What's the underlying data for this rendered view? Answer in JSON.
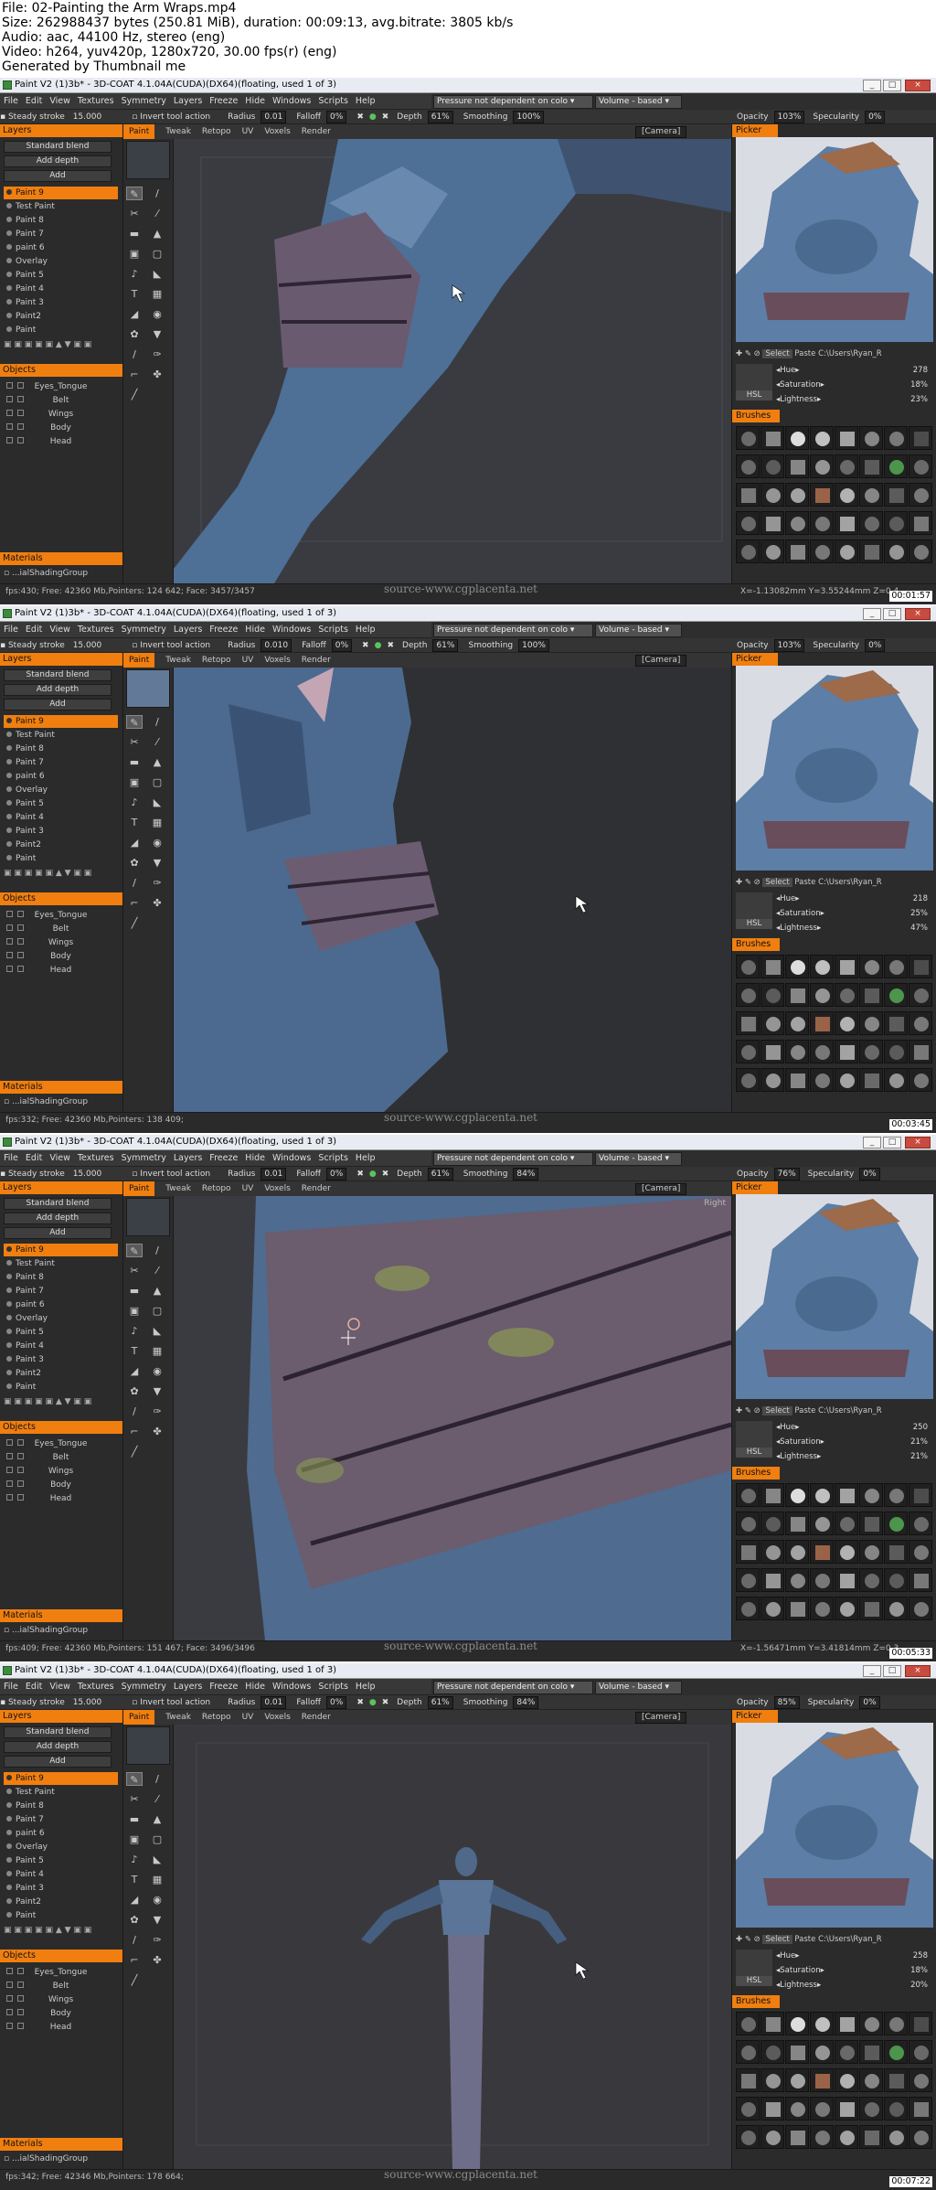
{
  "header": {
    "file": "File: 02-Painting the Arm Wraps.mp4",
    "size": "Size: 262988437 bytes (250.81 MiB), duration: 00:09:13, avg.bitrate: 3805 kb/s",
    "audio": "Audio: aac, 44100 Hz, stereo (eng)",
    "video": "Video: h264, yuv420p, 1280x720, 30.00 fps(r) (eng)",
    "generated": "Generated by Thumbnail me"
  },
  "window_buttons": {
    "minimize": "_",
    "maximize": "□",
    "close": "×"
  },
  "menu": [
    "File",
    "Edit",
    "View",
    "Textures",
    "Symmetry",
    "Layers",
    "Freeze",
    "Hide",
    "Windows",
    "Scripts",
    "Help"
  ],
  "pressure_dropdown": "Pressure not dependent on colo",
  "volume_dropdown": "Volume - based",
  "toolbar": {
    "steady_label": "Steady stroke",
    "steady_value": "15.000",
    "invert_label": "Invert tool action",
    "radius_label": "Radius",
    "falloff_label": "Falloff",
    "falloff_value": "0%",
    "depth_label": "Depth",
    "depth_value": "61%",
    "smoothing_label": "Smoothing",
    "opacity_label": "Opacity",
    "specularity_label": "Specularity",
    "specularity_value": "0%"
  },
  "room_tabs": [
    "Paint",
    "Tweak",
    "Retopo",
    "UV",
    "Voxels",
    "Render"
  ],
  "camera_label": "[Camera]",
  "panels": {
    "layers": "Layers",
    "objects": "Objects",
    "materials": "Materials",
    "picker": "Picker",
    "brushes": "Brushes"
  },
  "layer_controls": {
    "blend": "Standard blend",
    "depth": "Add depth",
    "add": "Add"
  },
  "layers": [
    "Paint 9",
    "Test Paint",
    "Paint 8",
    "Paint 7",
    "paint 6",
    "Overlay",
    "Paint 5",
    "Paint 4",
    "Paint 3",
    "Paint2",
    "Paint"
  ],
  "objects": [
    "Eyes_Tongue",
    "Belt",
    "Wings",
    "Body",
    "Head"
  ],
  "material_item": "...ialShadingGroup",
  "picker_row": {
    "select": "Select",
    "paste": "Paste",
    "path": "C:\\Users\\Ryan_R"
  },
  "hsl_labels": {
    "hue": "Hue",
    "saturation": "Saturation",
    "lightness": "Lightness",
    "mode": "HSL"
  },
  "watermark": "source-www.cgplacenta.net",
  "frames": [
    {
      "title": "Paint V2 (1)3b* - 3D-COAT 4.1.04A(CUDA)(DX64)(floating, used 1 of 3)",
      "radius_value": "0.01",
      "smoothing_value": "100%",
      "opacity_value": "103%",
      "hue": "278",
      "saturation": "18%",
      "lightness": "23%",
      "status_left": "fps:430;  Free: 42360 Mb,Pointers: 124 642; Face: 3457/3457",
      "status_right": "X=-1.13082mm  Y=3.55244mm  Z=0.4",
      "timestamp": "00:01:57",
      "view_label": ""
    },
    {
      "title": "Paint V2 (1)3b* - 3D-COAT 4.1.04A(CUDA)(DX64)(floating, used 1 of 3)",
      "radius_value": "0.010",
      "smoothing_value": "100%",
      "opacity_value": "103%",
      "hue": "218",
      "saturation": "25%",
      "lightness": "47%",
      "status_left": "fps:332;  Free: 42360 Mb,Pointers: 138 409;",
      "status_right": "",
      "timestamp": "00:03:45",
      "view_label": ""
    },
    {
      "title": "Paint V2 (1)3b* - 3D-COAT 4.1.04A(CUDA)(DX64)(floating, used 1 of 3)",
      "radius_value": "0.01",
      "smoothing_value": "84%",
      "opacity_value": "76%",
      "hue": "250",
      "saturation": "21%",
      "lightness": "21%",
      "status_left": "fps:409;  Free: 42360 Mb,Pointers: 151 467; Face: 3496/3496",
      "status_right": "X=-1.56471mm  Y=3.41814mm  Z=0.3",
      "timestamp": "00:05:33",
      "view_label": "Right"
    },
    {
      "title": "Paint V2 (1)3b* - 3D-COAT 4.1.04A(CUDA)(DX64)(floating, used 1 of 3)",
      "radius_value": "0.01",
      "smoothing_value": "84%",
      "opacity_value": "85%",
      "hue": "258",
      "saturation": "18%",
      "lightness": "20%",
      "status_left": "fps:342;  Free: 42346 Mb,Pointers: 178 664;",
      "status_right": "",
      "timestamp": "00:07:22",
      "view_label": ""
    }
  ]
}
